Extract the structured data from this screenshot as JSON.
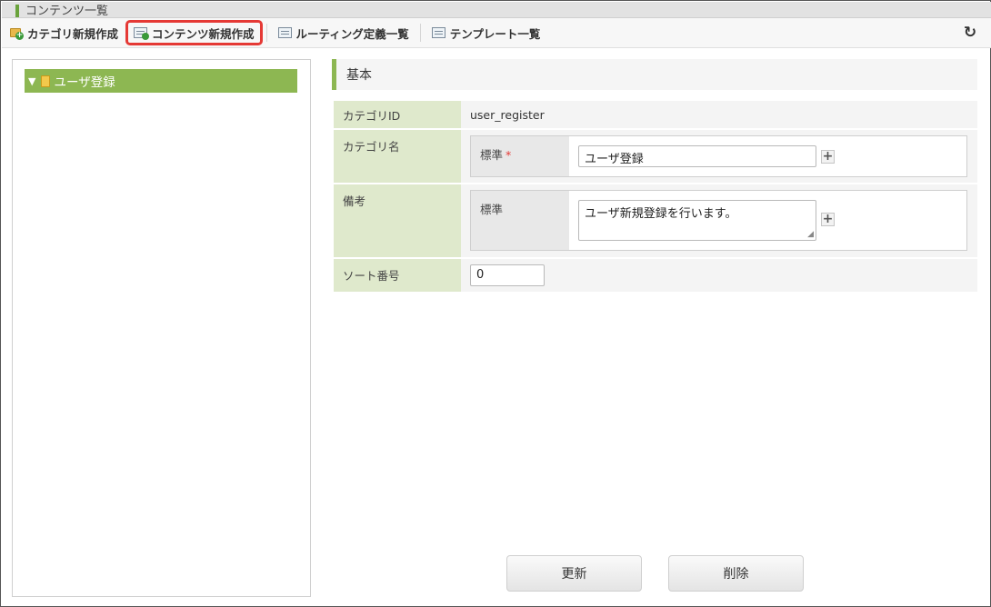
{
  "window": {
    "title": "コンテンツ一覧"
  },
  "toolbar": {
    "items": [
      {
        "label": "カテゴリ新規作成",
        "icon": "folder-add-icon"
      },
      {
        "label": "コンテンツ新規作成",
        "icon": "document-add-icon",
        "highlighted": true
      },
      {
        "label": "ルーティング定義一覧",
        "icon": "list-icon"
      },
      {
        "label": "テンプレート一覧",
        "icon": "list-icon"
      }
    ],
    "refresh_symbol": "C",
    "highlight_color": "#e53935"
  },
  "tree": {
    "nodes": [
      {
        "label": "ユーザ登録",
        "expanded_symbol": "▼",
        "selected": true
      }
    ],
    "selected_color": "#8db752"
  },
  "section": {
    "title": "基本"
  },
  "form": {
    "category_id": {
      "label": "カテゴリID",
      "value": "user_register"
    },
    "category_name": {
      "label": "カテゴリ名",
      "locale_label": "標準",
      "required_mark": "*",
      "value": "ユーザ登録",
      "add_symbol": "+"
    },
    "remarks": {
      "label": "備考",
      "locale_label": "標準",
      "value": "ユーザ新規登録を行います。",
      "add_symbol": "+"
    },
    "sort_number": {
      "label": "ソート番号",
      "value": "0"
    }
  },
  "buttons": {
    "update": "更新",
    "delete": "削除"
  }
}
